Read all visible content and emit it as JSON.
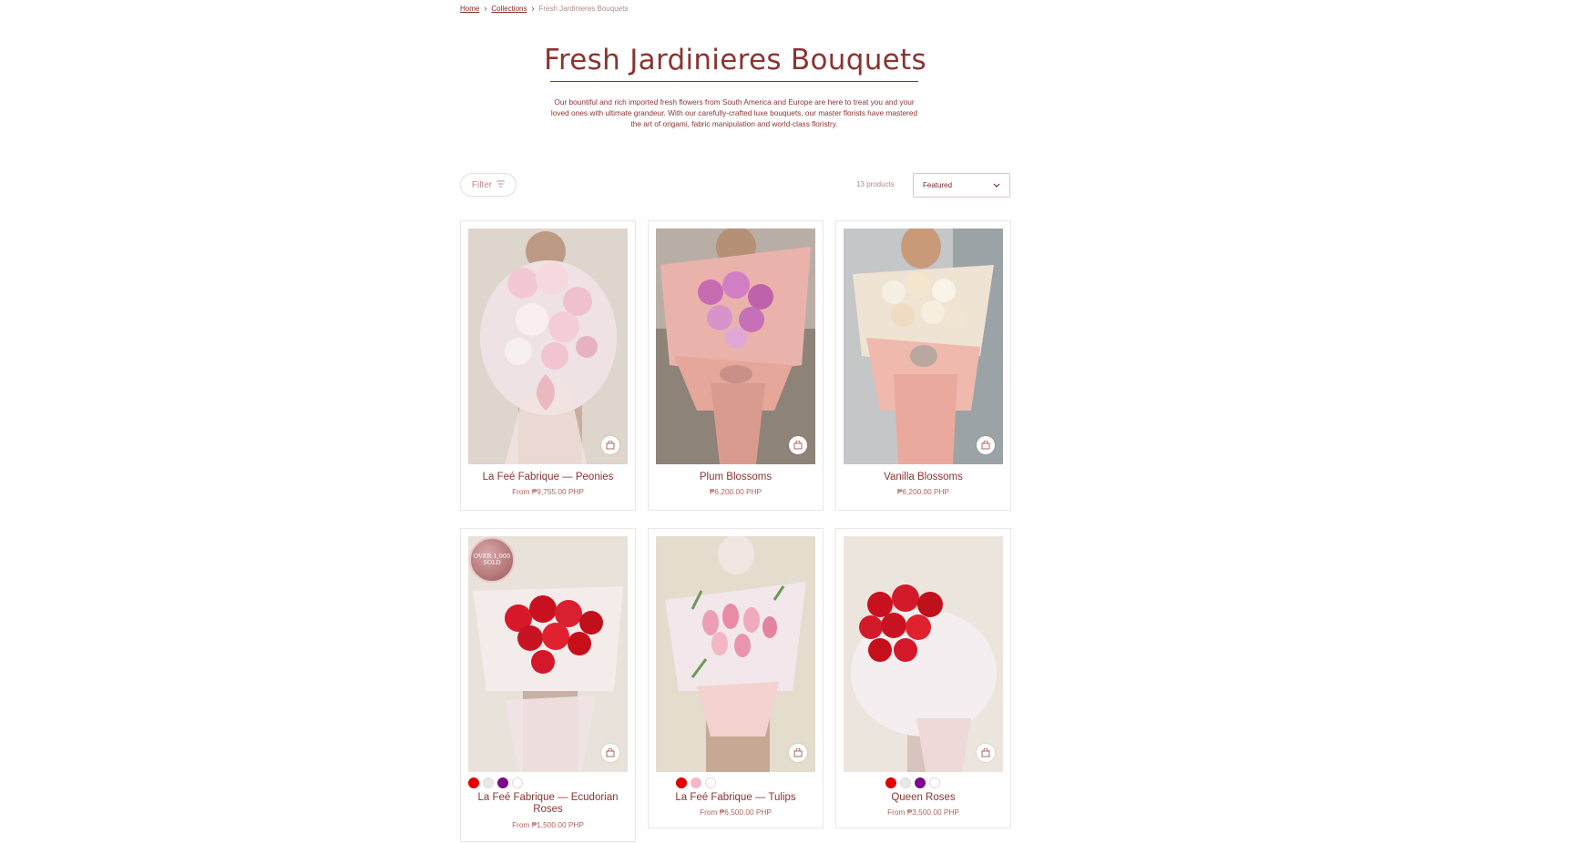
{
  "breadcrumb": {
    "home": "Home",
    "collections": "Collections",
    "current": "Fresh Jardinieres Bouquets"
  },
  "page": {
    "title": "Fresh Jardinieres Bouquets",
    "description": "Our bountiful and rich imported fresh flowers from South America and Europe are here to treat you and your loved ones with ultimate grandeur. With our carefully-crafted luxe bouquets, our master florists have mastered the art of origami, fabric manipulation and world-class floristry."
  },
  "toolbar": {
    "filter_label": "Filter",
    "count_label": "13 products",
    "sort_value": "Featured"
  },
  "products": [
    {
      "name": "La Feé Fabrique — Peonies",
      "price": "From ₱9,755.00 PHP"
    },
    {
      "name": "Plum Blossoms",
      "price": "₱6,200.00 PHP"
    },
    {
      "name": "Vanilla Blossoms",
      "price": "₱6,200.00 PHP"
    },
    {
      "name": "La Feé Fabrique — Ecudorian Roses",
      "price": "From ₱1,500.00 PHP",
      "badge": "OVER 1,000 SOLD",
      "swatches": [
        "#e00000",
        "#e8e8e8",
        "#7a0a8a",
        "#ffffff"
      ]
    },
    {
      "name": "La Feé Fabrique — Tulips",
      "price": "From ₱6,500.00 PHP",
      "swatches": [
        "#e00000",
        "#f4b8c4",
        "#ffffff"
      ]
    },
    {
      "name": "Queen Roses",
      "price": "From ₱3,500.00 PHP",
      "swatches": [
        "#e00000",
        "#e8e8e8",
        "#7a0a8a",
        "#ffffff"
      ]
    }
  ],
  "colors": {
    "brand": "#8a3432",
    "accent": "#b0645e"
  }
}
